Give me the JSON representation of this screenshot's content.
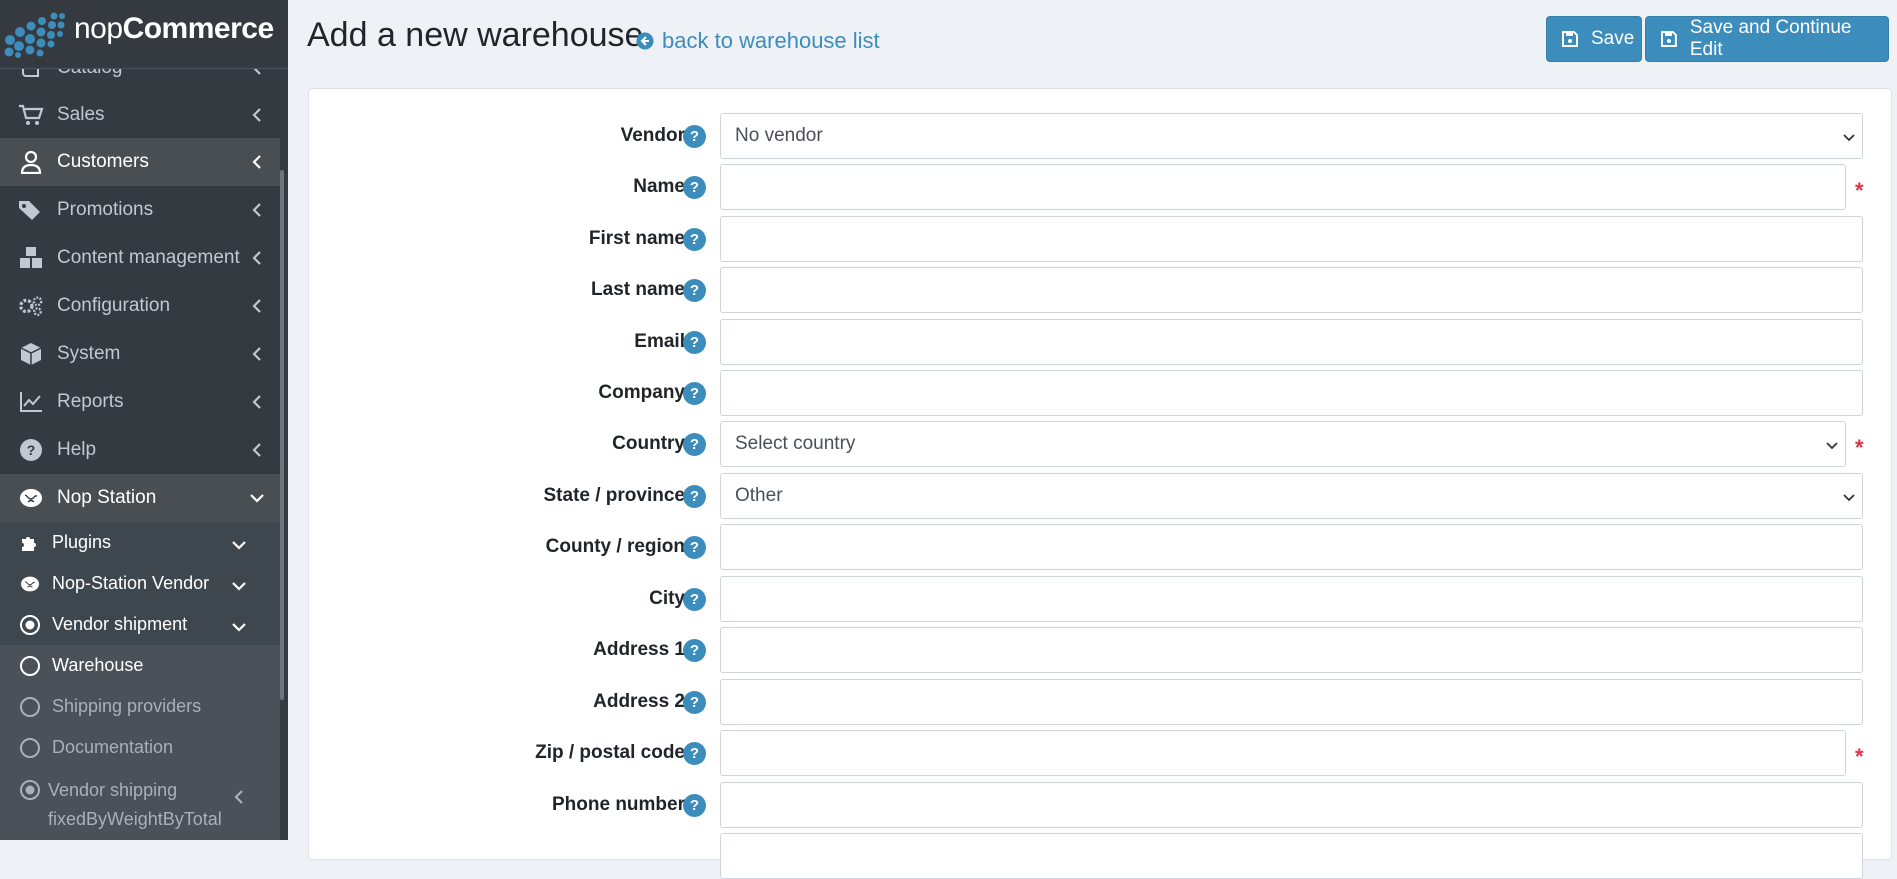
{
  "brand": {
    "name_light": "nop",
    "name_bold": "Commerce"
  },
  "sidebar": {
    "items": [
      {
        "label": "Catalog",
        "icon": "book-icon"
      },
      {
        "label": "Sales",
        "icon": "cart-icon"
      },
      {
        "label": "Customers",
        "icon": "user-icon"
      },
      {
        "label": "Promotions",
        "icon": "tags-icon"
      },
      {
        "label": "Content management",
        "icon": "cubes-icon"
      },
      {
        "label": "Configuration",
        "icon": "gears-icon"
      },
      {
        "label": "System",
        "icon": "cube-icon"
      },
      {
        "label": "Reports",
        "icon": "line-chart-icon"
      },
      {
        "label": "Help",
        "icon": "question-circle-icon"
      },
      {
        "label": "Nop Station",
        "icon": "brain-icon"
      }
    ],
    "sub_items": [
      {
        "label": "Plugins",
        "icon": "puzzle-icon"
      },
      {
        "label": "Nop-Station Vendor",
        "icon": "brain-icon"
      },
      {
        "label": "Vendor shipment",
        "icon": "dot-circle-icon"
      },
      {
        "label": "Warehouse",
        "icon": "circle-icon"
      },
      {
        "label": "Shipping providers",
        "icon": "circle-icon"
      },
      {
        "label": "Documentation",
        "icon": "circle-icon"
      },
      {
        "label_line1": "Vendor shipping",
        "label_line2": "fixedByWeightByTotal",
        "icon": "dot-circle-icon"
      }
    ]
  },
  "header": {
    "title": "Add a new warehouse",
    "back_link": "back to warehouse list",
    "save_label": "Save",
    "save_continue_label": "Save and Continue Edit"
  },
  "form": {
    "help_glyph": "?",
    "required_mark": "*",
    "vendor": {
      "label": "Vendor",
      "value": "No vendor"
    },
    "name": {
      "label": "Name",
      "value": ""
    },
    "first_name": {
      "label": "First name",
      "value": ""
    },
    "last_name": {
      "label": "Last name",
      "value": ""
    },
    "email": {
      "label": "Email",
      "value": ""
    },
    "company": {
      "label": "Company",
      "value": ""
    },
    "country": {
      "label": "Country",
      "value": "Select country"
    },
    "state": {
      "label": "State / province",
      "value": "Other"
    },
    "county": {
      "label": "County / region",
      "value": ""
    },
    "city": {
      "label": "City",
      "value": ""
    },
    "address1": {
      "label": "Address 1",
      "value": ""
    },
    "address2": {
      "label": "Address 2",
      "value": ""
    },
    "zip": {
      "label": "Zip / postal code",
      "value": ""
    },
    "phone": {
      "label": "Phone number",
      "value": ""
    }
  },
  "colors": {
    "accent": "#3c8dbc",
    "sidebar": "#343a40",
    "required": "#dc3545"
  }
}
